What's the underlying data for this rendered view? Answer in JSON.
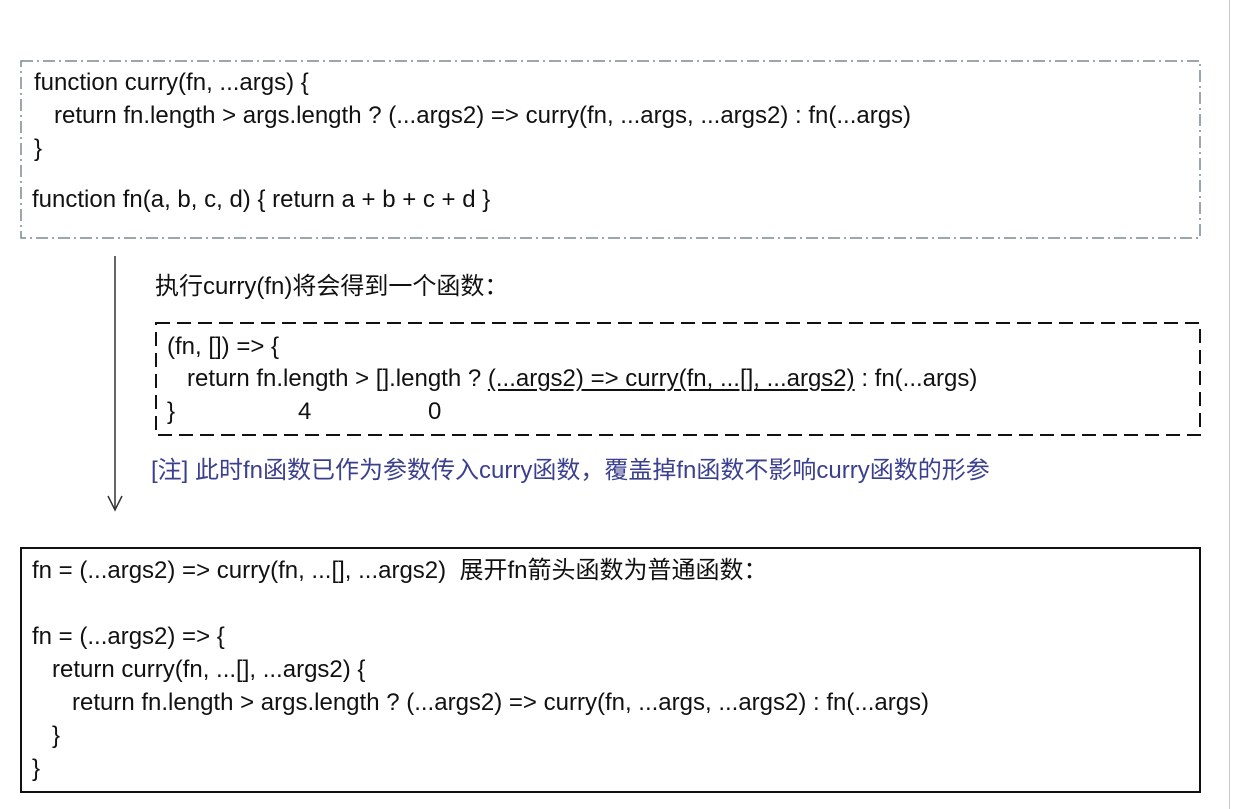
{
  "colors": {
    "text": "#111111",
    "note": "#3b3f8f",
    "border": "#111111",
    "dashdot_border": "#7a8a90"
  },
  "box1": {
    "lines": [
      "function curry(fn, ...args) {",
      "   return fn.length > args.length ? (...args2) => curry(fn, ...args, ...args2) : fn(...args)",
      "}",
      "function fn(a, b, c, d) { return a + b + c + d }"
    ]
  },
  "caption": "执行curry(fn)将会得到一个函数：",
  "box2": {
    "line1": "(fn, []) => {",
    "line2_prefix": "   return fn.length > [].length ? ",
    "line2_underlined": "(...args2) => curry(fn, ...[], ...args2)",
    "line2_suffix": " : fn(...args)",
    "line3_brace": "}",
    "annot_4": "4",
    "annot_0": "0"
  },
  "note": "[注] 此时fn函数已作为参数传入curry函数，覆盖掉fn函数不影响curry函数的形参",
  "box3": {
    "line1_code": "fn = (...args2) => curry(fn, ...[], ...args2)",
    "line1_cn": "  展开fn箭头函数为普通函数：",
    "lines": [
      "fn = (...args2) => {",
      "   return curry(fn, ...[], ...args2) {",
      "      return fn.length > args.length ? (...args2) => curry(fn, ...args, ...args2) : fn(...args)",
      "   }",
      "}"
    ]
  }
}
